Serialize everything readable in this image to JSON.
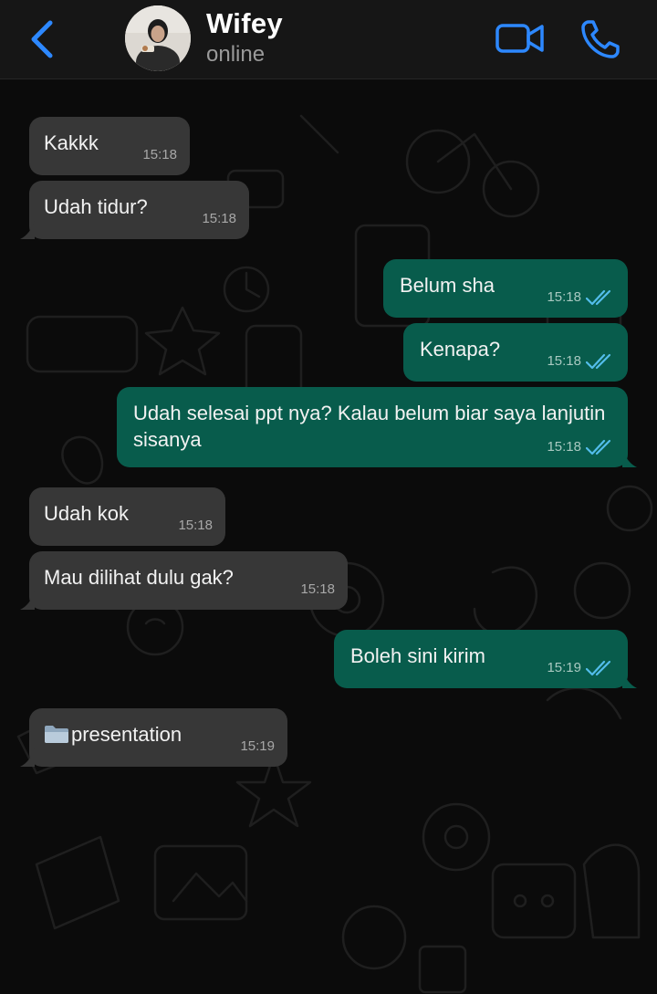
{
  "header": {
    "contact_name": "Wifey",
    "status": "online",
    "back_icon": "chevron-left-icon",
    "video_icon": "video-camera-icon",
    "call_icon": "phone-icon",
    "accent_color": "#2d88ff"
  },
  "messages": [
    {
      "direction": "in",
      "text": "Kakkk",
      "time": "15:18"
    },
    {
      "direction": "in",
      "text": "Udah tidur?",
      "time": "15:18"
    },
    {
      "direction": "out",
      "text": "Belum sha",
      "time": "15:18",
      "status": "read"
    },
    {
      "direction": "out",
      "text": "Kenapa?",
      "time": "15:18",
      "status": "read"
    },
    {
      "direction": "out",
      "text": "Udah selesai ppt nya? Kalau belum biar saya lanjutin sisanya",
      "time": "15:18",
      "status": "read"
    },
    {
      "direction": "in",
      "text": "Udah kok",
      "time": "15:18"
    },
    {
      "direction": "in",
      "text": "Mau dilihat dulu gak?",
      "time": "15:18"
    },
    {
      "direction": "out",
      "text": "Boleh sini kirim",
      "time": "15:19",
      "status": "read"
    },
    {
      "direction": "in",
      "text": "presentation",
      "icon": "folder-icon",
      "time": "15:19"
    }
  ],
  "colors": {
    "incoming_bubble": "#373737",
    "outgoing_bubble": "#085c4c",
    "read_receipt": "#53bdeb"
  }
}
